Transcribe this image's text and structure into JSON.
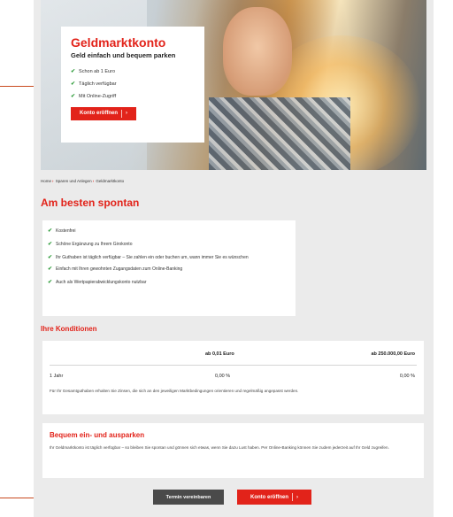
{
  "hero": {
    "image": "woman-smiling-in-car-photo",
    "title": "Geldmarktkonto",
    "subtitle": "Geld einfach und bequem parken",
    "bullets": [
      "Schon ab 1 Euro",
      "Täglich verfügbar",
      "Mit Online-Zugriff"
    ],
    "cta_label": "Konto eröffnen",
    "cta_icon": "chevron-right-icon"
  },
  "breadcrumb": [
    "Home",
    "Sparen und Anlegen",
    "Geldmarktkonto"
  ],
  "section_title": "Am besten spontan",
  "features": [
    "Kostenfrei",
    "Schöne Ergänzung zu Ihrem Girokonto",
    "Ihr Guthaben ist täglich verfügbar – Sie zahlen ein oder buchen um, wann immer Sie es wünschen",
    "Einfach mit Ihren gewohnten Zugangsdaten zum Online-Banking",
    "Auch als Wertpapierabwicklungskonto nutzbar"
  ],
  "conditions": {
    "title": "Ihre Konditionen",
    "headers": [
      "ab 0,01 Euro",
      "ab 250.000,00 Euro"
    ],
    "row_label": "1 Jahr",
    "row_values": [
      "0,00 %",
      "0,00 %"
    ],
    "note": "Für Ihr Gesamtguthaben erhalten Sie Zinsen, die sich an den jeweiligen Marktbedingungen orientieren und regelmäßig angepasst werden."
  },
  "info": {
    "title": "Bequem ein- und ausparken",
    "text": "Ihr Geldmarktkonto ist täglich verfügbar – so bleiben Sie spontan und gönnen sich etwas, wenn Sie dazu Lust haben. Per Online-Banking können Sie zudem jederzeit auf Ihr Geld zugreifen."
  },
  "buttons": {
    "appointment": "Termin vereinbaren",
    "open_account": "Konto eröffnen"
  },
  "colors": {
    "accent_red": "#e2231a",
    "check_green": "#2e9b3a",
    "page_bg": "#ebebeb",
    "button_dark": "#4a4a4a",
    "annotation_line": "#c84a1e"
  }
}
